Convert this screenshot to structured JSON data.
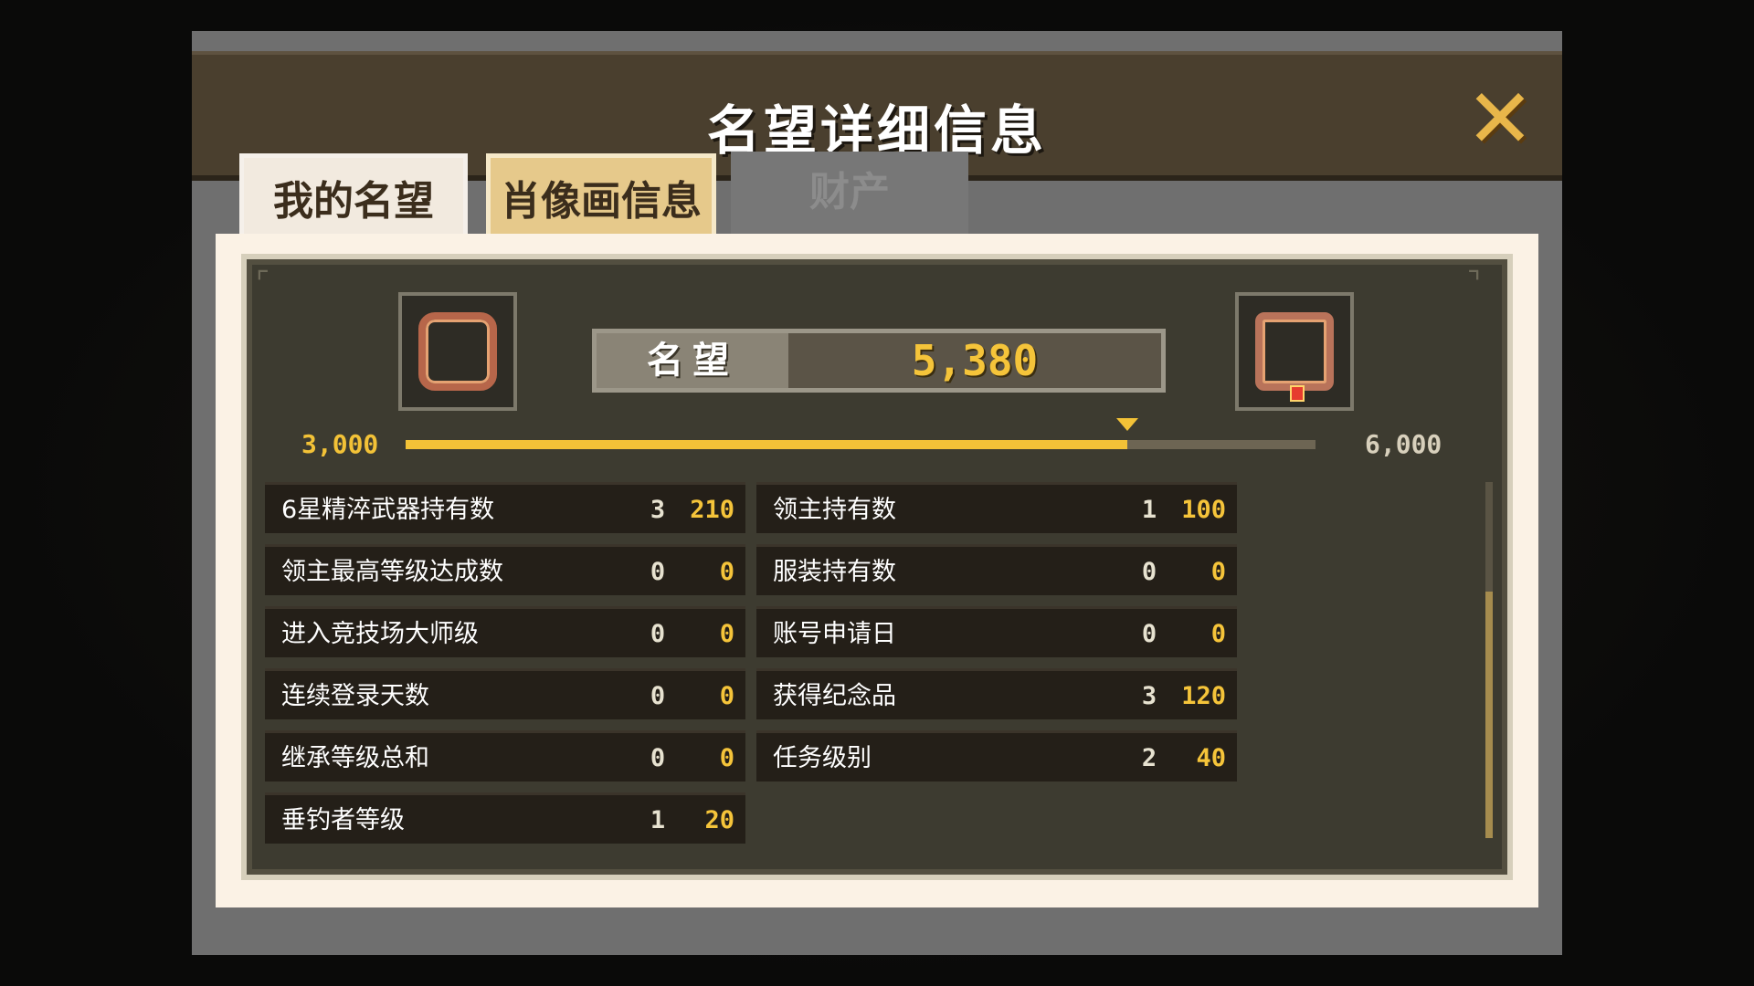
{
  "title": "名望详细信息",
  "tabs": [
    {
      "label": "我的名望",
      "active": true
    },
    {
      "label": "肖像画信息",
      "active": false
    }
  ],
  "background_tab": "财产",
  "fame": {
    "label": "名望",
    "value": "5,380",
    "range_min": "3,000",
    "range_max": "6,000",
    "progress_fraction": 0.793
  },
  "stats_left": [
    {
      "label": "6星精淬武器持有数",
      "count": "3",
      "points": "210"
    },
    {
      "label": "领主最高等级达成数",
      "count": "0",
      "points": "0"
    },
    {
      "label": "进入竞技场大师级",
      "count": "0",
      "points": "0"
    },
    {
      "label": "连续登录天数",
      "count": "0",
      "points": "0"
    },
    {
      "label": "继承等级总和",
      "count": "0",
      "points": "0"
    },
    {
      "label": "垂钓者等级",
      "count": "1",
      "points": "20"
    }
  ],
  "stats_right": [
    {
      "label": "领主持有数",
      "count": "1",
      "points": "100"
    },
    {
      "label": "服装持有数",
      "count": "0",
      "points": "0"
    },
    {
      "label": "账号申请日",
      "count": "0",
      "points": "0"
    },
    {
      "label": "获得纪念品",
      "count": "3",
      "points": "120"
    },
    {
      "label": "任务级别",
      "count": "2",
      "points": "40"
    }
  ],
  "colors": {
    "accent_gold": "#f5c43a",
    "header_brown": "#4a3f2e",
    "panel_dark": "#3d3b30",
    "close_icon": "#e8b64a"
  },
  "icons": {
    "close": "close-x-icon",
    "current_rank_frame": "bronze-frame-icon",
    "next_rank_frame": "ornate-frame-icon"
  }
}
